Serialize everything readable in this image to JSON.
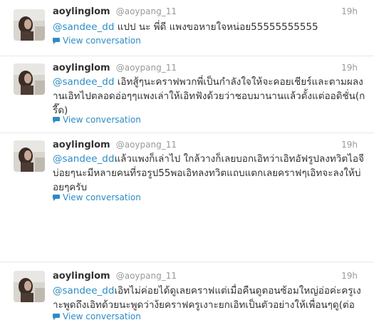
{
  "tweets": [
    {
      "name": "aoylinglom",
      "handle": "@aoypang_11",
      "time": "19h",
      "mention": "@sandee_dd",
      "text": " แปป นะ พี่ดี แพงขอหายใจหน่อย55555555555",
      "link": "View conversation"
    },
    {
      "name": "aoylinglom",
      "handle": "@aoypang_11",
      "time": "19h",
      "mention": "@sandee_dd",
      "text": " เอิทสู้ๆนะคราฟพวกพี่เป็นกำลังใจให้จะคอยเชียร์และตามผลงานเอิทไปตลอดอ่อๆๆแพงเล่าให้เอิทฟังด้วยว่าชอบมานานแล้วตั้งแต่ออดิชั่น(กรี๊ด)",
      "link": "View conversation"
    },
    {
      "name": "aoylinglom",
      "handle": "@aoypang_11",
      "time": "19h",
      "mention": "@sandee_dd",
      "text": "แล้วแพงก็เล่าไป ใกล้วางก็เลยบอกเอิทว่าเอิทอัฟรูปลงทวิตไอจีบ่อยๆนะมีหลายคนที่รอรูป55พอเอิทลงทวิตแถบแตกเลยคราฟๆเอิทจะลงให้บ่อยๆครับ",
      "link": "View conversation"
    },
    {
      "name": "aoylinglom",
      "handle": "@aoypang_11",
      "time": "19h",
      "mention": "@sandee_dd",
      "text": "เอิทไม่ค่อยได้ดูเลยคราฟแต่เมื่อคืนดูตอนซ้อมใหญ่อ่อค่ะครูเงาะพูดถึงเอิทด้วยนะพูดว่าง้ยคราฟครูเงาะยกเอิทเป็นตัวอย่างให้เพื่อนๆดู(ต่อ",
      "link": "View conversation"
    }
  ],
  "colors": {
    "mention": "#2c8cc5",
    "name": "#333333",
    "meta": "#999999",
    "divider": "#e8e8e8"
  },
  "icons": {
    "avatar": "profile-photo",
    "conversation": "speech-bubble-icon"
  }
}
